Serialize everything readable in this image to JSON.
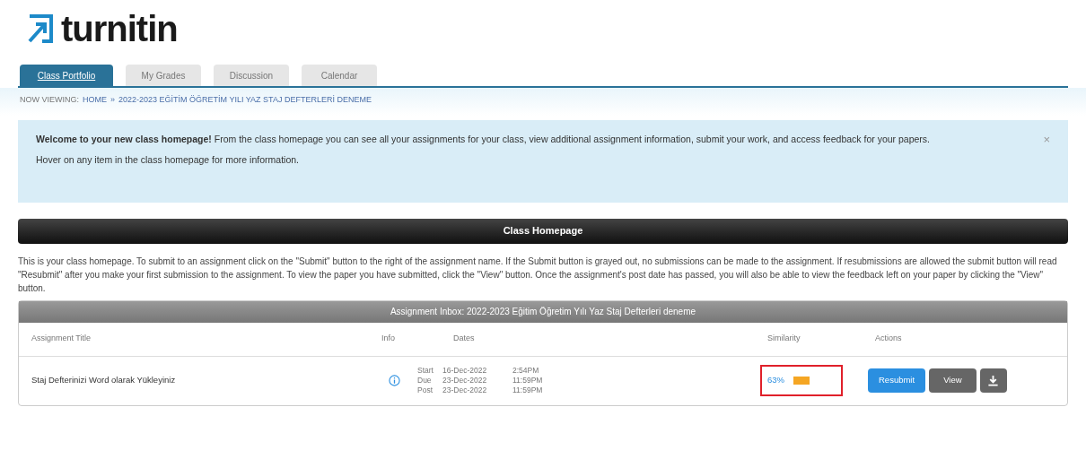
{
  "logo": {
    "text": "turnitin"
  },
  "tabs": [
    {
      "label": "Class Portfolio",
      "selected": true
    },
    {
      "label": "My Grades",
      "selected": false
    },
    {
      "label": "Discussion",
      "selected": false
    },
    {
      "label": "Calendar",
      "selected": false
    }
  ],
  "breadcrumb": {
    "prefix": "NOW VIEWING:",
    "home": "HOME",
    "separator": "»",
    "current": "2022-2023 EĞİTİM ÖĞRETİM YILI YAZ STAJ DEFTERLERİ DENEME"
  },
  "alert": {
    "message": "**Welcome to your new class homepage!** From the class homepage you can see all your assignments for your class, view additional assignment information, submit your work, and access feedback for your papers.",
    "hint": "Hover on any item in the class homepage for more information.",
    "close": "×"
  },
  "section_title": "Class Homepage",
  "intro": "This is your class homepage. To submit to an assignment click on the \"Submit\" button to the right of the assignment name. If the Submit button is grayed out, no submissions can be made to the assignment. If resubmissions are allowed the submit button will read \"Resubmit\" after you make your first submission to the assignment. To view the paper you have submitted, click the \"View\" button. Once the assignment's post date has passed, you will also be able to view the feedback left on your paper by clicking the \"View\" button.",
  "inbox": {
    "title": "Assignment Inbox: 2022-2023 Eğitim Öğretim Yılı Yaz Staj Defterleri deneme",
    "columns": [
      "Assignment Title",
      "Info",
      "Dates",
      "Similarity",
      "Actions"
    ],
    "rows": [
      {
        "title": "Staj Defterinizi Word olarak Yükleyiniz",
        "dates": [
          {
            "label": "Start",
            "date": "16-Dec-2022",
            "time": "2:54PM"
          },
          {
            "label": "Due",
            "date": "23-Dec-2022",
            "time": "11:59PM"
          },
          {
            "label": "Post",
            "date": "23-Dec-2022",
            "time": "11:59PM"
          }
        ],
        "similarity": "63%",
        "color": "#f5a623",
        "highlighted": true,
        "buttons": [
          "Resubmit",
          "View"
        ]
      }
    ]
  }
}
